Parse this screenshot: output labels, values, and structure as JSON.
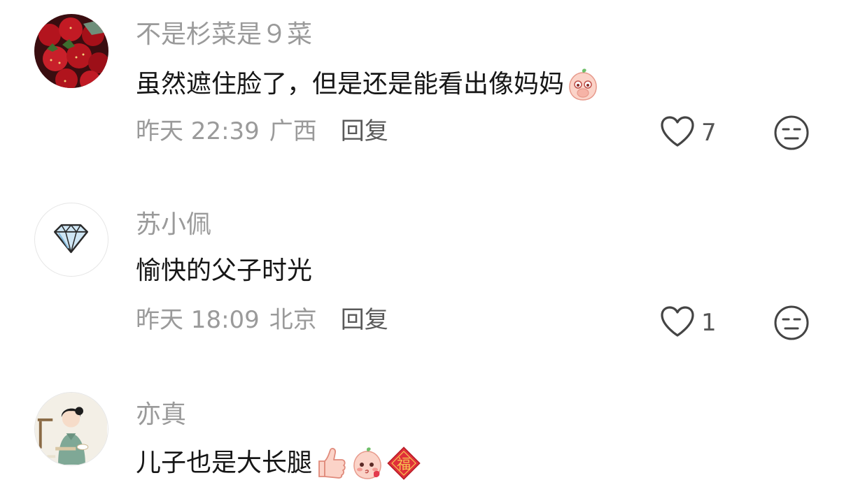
{
  "comments": [
    {
      "username": "不是杉菜是９菜",
      "avatar_icon": "strawberry-avatar-icon",
      "text": "虽然遮住脸了，但是还是能看出像妈妈",
      "emojis": [
        "peach-cover-face-emoji"
      ],
      "time": "昨天 22:39",
      "region": "广西",
      "reply_label": "回复",
      "like_count": "7"
    },
    {
      "username": "苏小佩",
      "avatar_icon": "diamond-avatar-icon",
      "text": "愉快的父子时光",
      "emojis": [],
      "time": "昨天 18:09",
      "region": "北京",
      "reply_label": "回复",
      "like_count": "1"
    },
    {
      "username": "亦真",
      "avatar_icon": "tea-woman-avatar-icon",
      "text": "儿子也是大长腿",
      "emojis": [
        "thumbs-up-emoji",
        "peach-blush-emoji",
        "fortune-fu-emoji"
      ]
    }
  ],
  "colors": {
    "username": "#9a9a9a",
    "content": "#161616",
    "meta": "#9a9a9a",
    "reply": "#5a5a5a",
    "icon_stroke": "#444444"
  }
}
